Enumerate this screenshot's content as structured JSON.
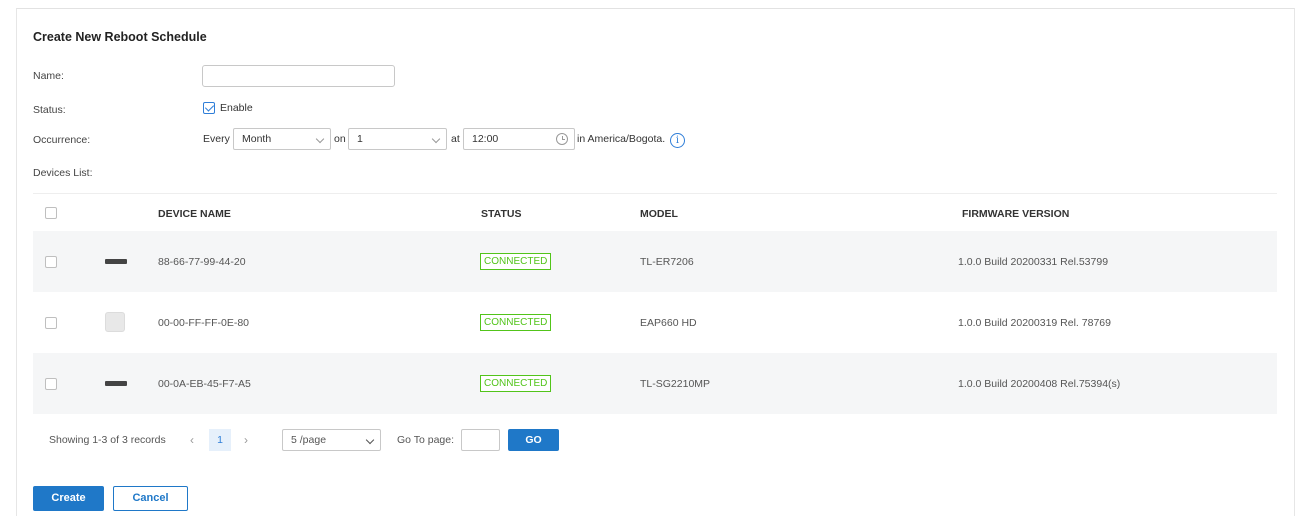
{
  "form": {
    "title": "Create New Reboot Schedule",
    "name_label": "Name:",
    "name_value": "",
    "status_label": "Status:",
    "enable_label": "Enable",
    "occurrence_label": "Occurrence:",
    "every_label": "Every",
    "frequency_value": "Month",
    "on_label": "on",
    "day_value": "1",
    "at_label": "at",
    "time_value": "12:00",
    "timezone_text": "in America/Bogota.",
    "devices_list_label": "Devices List:"
  },
  "table": {
    "columns": [
      "DEVICE NAME",
      "STATUS",
      "MODEL",
      "FIRMWARE VERSION"
    ],
    "rows": [
      {
        "icon": "router-icon",
        "name": "88-66-77-99-44-20",
        "status": "CONNECTED",
        "model": "TL-ER7206",
        "firmware": "1.0.0 Build 20200331 Rel.53799"
      },
      {
        "icon": "access-point-icon",
        "name": "00-00-FF-FF-0E-80",
        "status": "CONNECTED",
        "model": "EAP660 HD",
        "firmware": "1.0.0 Build 20200319 Rel. 78769"
      },
      {
        "icon": "switch-icon",
        "name": "00-0A-EB-45-F7-A5",
        "status": "CONNECTED",
        "model": "TL-SG2210MP",
        "firmware": "1.0.0 Build 20200408 Rel.75394(s)"
      }
    ]
  },
  "pagination": {
    "showing": "Showing 1-3 of 3 records",
    "prev": "‹",
    "current_page": "1",
    "next": "›",
    "per_page": "5 /page",
    "goto_label": "Go To page:",
    "go_label": "GO"
  },
  "actions": {
    "create_label": "Create",
    "cancel_label": "Cancel"
  },
  "colors": {
    "primary": "#1f78c8",
    "connected": "#52c41a"
  }
}
